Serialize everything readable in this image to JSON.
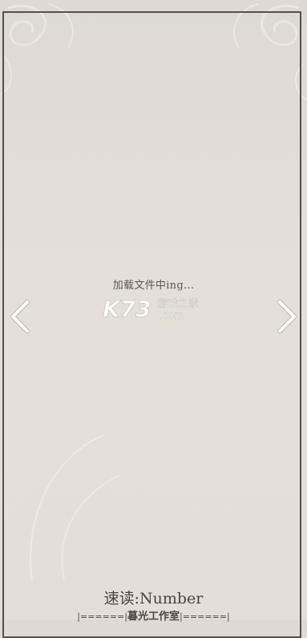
{
  "loading_text": "加载文件中ing...",
  "watermark": {
    "brand": "K73",
    "tagline": "游戏之家",
    "domain": ".com"
  },
  "footer": {
    "title": "速读:Number",
    "divider_left": "|======|",
    "studio": "暮光工作室",
    "divider_right": "|======|"
  },
  "icons": {
    "prev": "chevron-left-icon",
    "next": "chevron-right-icon"
  },
  "colors": {
    "background": "#e2ded6",
    "frame": "#55504a",
    "text": "#4a4640",
    "arrow": "#ffffff"
  }
}
